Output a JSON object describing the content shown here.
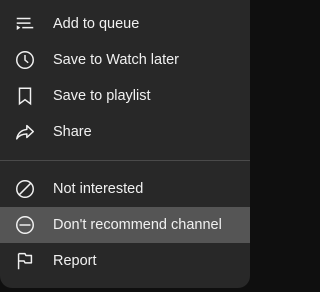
{
  "menu": {
    "items": [
      {
        "label": "Add to queue",
        "icon": "add-to-queue-icon"
      },
      {
        "label": "Save to Watch later",
        "icon": "clock-icon"
      },
      {
        "label": "Save to playlist",
        "icon": "bookmark-icon"
      },
      {
        "label": "Share",
        "icon": "share-arrow-icon"
      }
    ],
    "items2": [
      {
        "label": "Not interested",
        "icon": "block-icon"
      },
      {
        "label": "Don't recommend channel",
        "icon": "minus-circle-icon",
        "highlighted": true
      },
      {
        "label": "Report",
        "icon": "flag-icon"
      }
    ]
  },
  "colors": {
    "menu_bg": "#282828",
    "highlight_bg": "#555555",
    "text": "#f1f1f1",
    "page_bg": "#0f0f0f"
  }
}
